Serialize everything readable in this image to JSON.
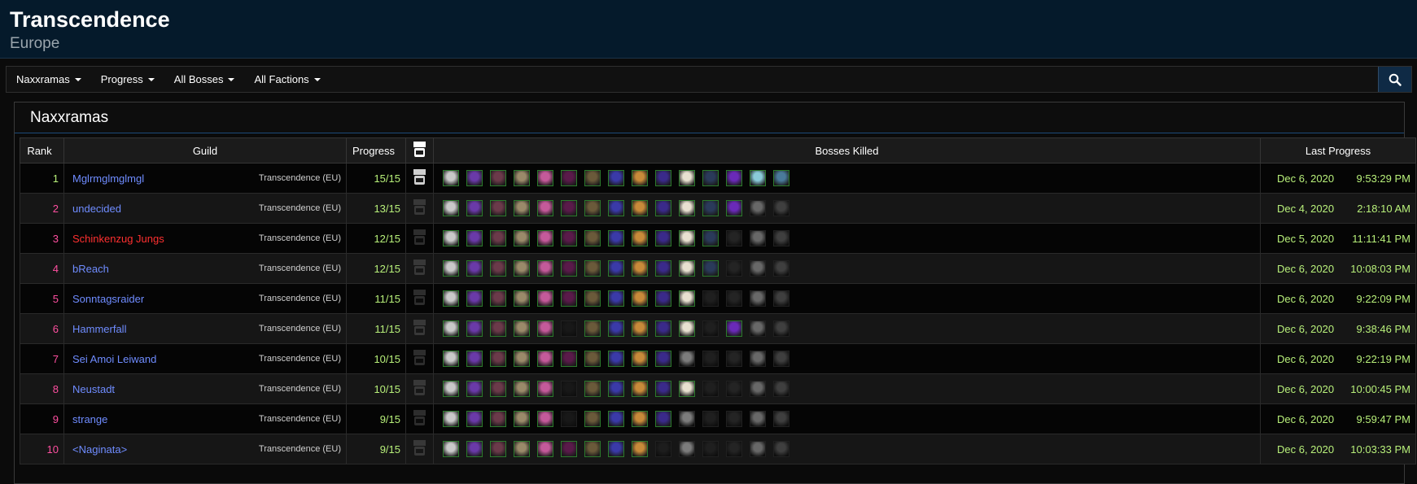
{
  "header": {
    "title": "Transcendence",
    "subtitle": "Europe"
  },
  "navbar": {
    "items": [
      {
        "label": "Naxxramas"
      },
      {
        "label": "Progress"
      },
      {
        "label": "All Bosses"
      },
      {
        "label": "All Factions"
      }
    ]
  },
  "panel": {
    "title": "Naxxramas"
  },
  "table": {
    "headers": {
      "rank": "Rank",
      "guild": "Guild",
      "progress": "Progress",
      "bosses": "Bosses Killed",
      "last": "Last Progress"
    },
    "rows": [
      {
        "rank": "1",
        "guild": "Mglrmglmglmgl",
        "realm": "Transcendence (EU)",
        "progress": "15/15",
        "date": "Dec 6, 2020",
        "time": "9:53:29 PM",
        "kills": "111111111111111",
        "video": true
      },
      {
        "rank": "2",
        "guild": "undecided",
        "realm": "Transcendence (EU)",
        "progress": "13/15",
        "date": "Dec 4, 2020",
        "time": "2:18:10 AM",
        "kills": "111111111111100",
        "video": false
      },
      {
        "rank": "3",
        "guild": "Schinkenzug Jungs",
        "realm": "Transcendence (EU)",
        "progress": "12/15",
        "date": "Dec 5, 2020",
        "time": "11:11:41 PM",
        "kills": "111111111111000",
        "video": false
      },
      {
        "rank": "4",
        "guild": "bReach",
        "realm": "Transcendence (EU)",
        "progress": "12/15",
        "date": "Dec 6, 2020",
        "time": "10:08:03 PM",
        "kills": "111111111111000",
        "video": false
      },
      {
        "rank": "5",
        "guild": "Sonntagsraider",
        "realm": "Transcendence (EU)",
        "progress": "11/15",
        "date": "Dec 6, 2020",
        "time": "9:22:09 PM",
        "kills": "111111111110000",
        "video": false
      },
      {
        "rank": "6",
        "guild": "Hammerfall",
        "realm": "Transcendence (EU)",
        "progress": "11/15",
        "date": "Dec 6, 2020",
        "time": "9:38:46 PM",
        "kills": "111110111110100",
        "video": false
      },
      {
        "rank": "7",
        "guild": "Sei Amoi Leiwand",
        "realm": "Transcendence (EU)",
        "progress": "10/15",
        "date": "Dec 6, 2020",
        "time": "9:22:19 PM",
        "kills": "111111111100000",
        "video": false
      },
      {
        "rank": "8",
        "guild": "Neustadt",
        "realm": "Transcendence (EU)",
        "progress": "10/15",
        "date": "Dec 6, 2020",
        "time": "10:00:45 PM",
        "kills": "111110111110000",
        "video": false
      },
      {
        "rank": "9",
        "guild": "strange",
        "realm": "Transcendence (EU)",
        "progress": "9/15",
        "date": "Dec 6, 2020",
        "time": "9:59:47 PM",
        "kills": "111110111100000",
        "video": false
      },
      {
        "rank": "10",
        "guild": "<Naginata>",
        "realm": "Transcendence (EU)",
        "progress": "9/15",
        "date": "Dec 6, 2020",
        "time": "10:03:33 PM",
        "kills": "111111111000000",
        "video": false
      }
    ]
  },
  "boss_colors": [
    "#c9c9c9",
    "#6a3aa8",
    "#6b3a4a",
    "#9a8a6a",
    "#c45a9a",
    "#5a1a4a",
    "#6a5a3a",
    "#3a3aa8",
    "#c88a3a",
    "#3a2a8a",
    "#e8e0d0",
    "#2a3a5a",
    "#6a2ab8",
    "#8acad8",
    "#4a7a9a"
  ],
  "colors": {
    "accent": "#6f8cff",
    "progress": "#b8f07a",
    "rank": "#ff4fa0",
    "red_guild": "#ff3030",
    "header_bg": "#051a2b"
  }
}
